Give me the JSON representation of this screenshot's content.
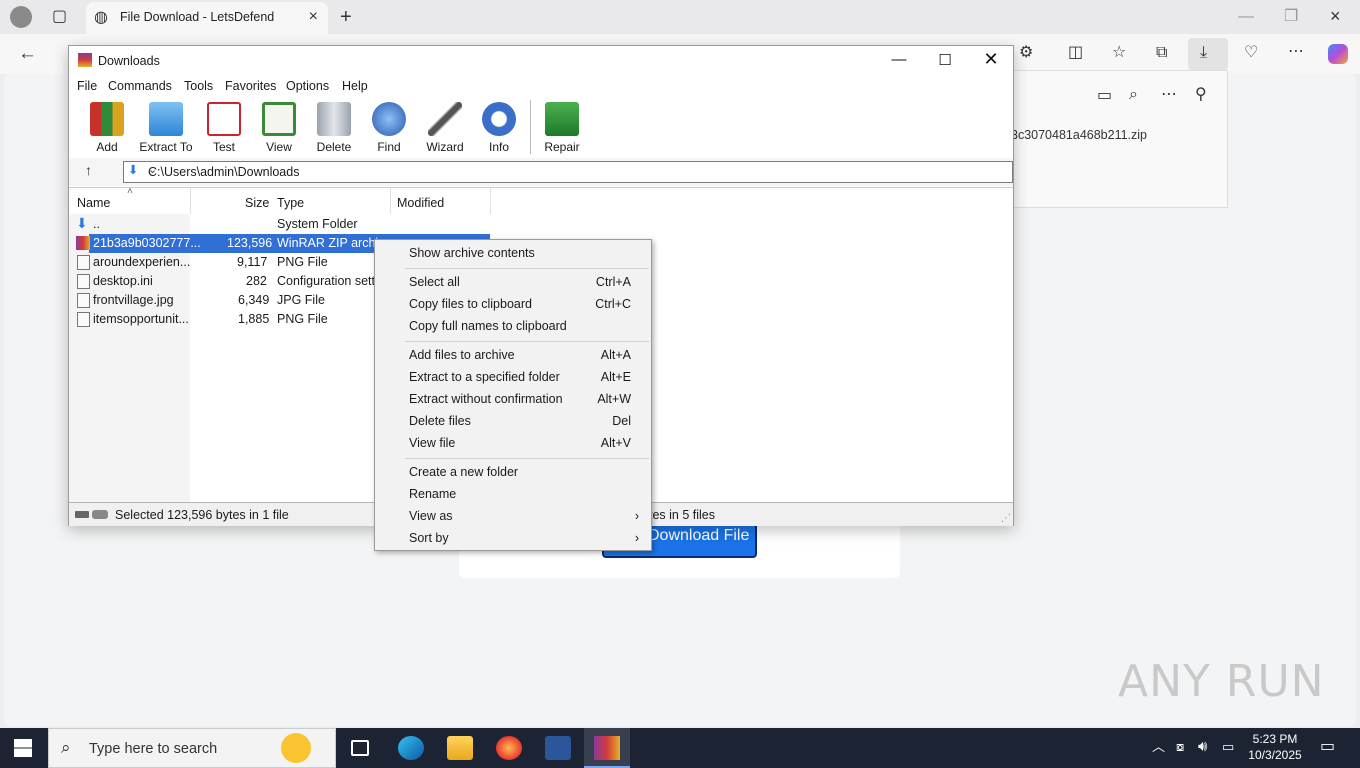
{
  "browser": {
    "tab_title": "File Download - LetsDefend",
    "download_filename": "3c3070481a468b211.zip",
    "page_button": "Download File",
    "watermark": "ANY RUN"
  },
  "winrar": {
    "title": "Downloads",
    "menu": [
      "File",
      "Commands",
      "Tools",
      "Favorites",
      "Options",
      "Help"
    ],
    "toolbar": [
      "Add",
      "Extract To",
      "Test",
      "View",
      "Delete",
      "Find",
      "Wizard",
      "Info",
      "Repair"
    ],
    "address": "C:\\Users\\admin\\Downloads",
    "columns": {
      "name": "Name",
      "size": "Size",
      "type": "Type",
      "modified": "Modified"
    },
    "files": [
      {
        "name": "..",
        "size": "",
        "type": "System Folder"
      },
      {
        "name": "21b3a9b0302777...",
        "size": "123,596",
        "type": "WinRAR ZIP archive"
      },
      {
        "name": "aroundexperien...",
        "size": "9,117",
        "type": "PNG File"
      },
      {
        "name": "desktop.ini",
        "size": "282",
        "type": "Configuration sett"
      },
      {
        "name": "frontvillage.jpg",
        "size": "6,349",
        "type": "JPG File"
      },
      {
        "name": "itemsopportunit...",
        "size": "1,885",
        "type": "PNG File"
      }
    ],
    "status_left": "Selected 123,596 bytes in 1 file",
    "status_right": "tes in 5 files"
  },
  "context_menu": [
    {
      "label": "Show archive contents",
      "key": ""
    },
    {
      "label": "Select all",
      "key": "Ctrl+A"
    },
    {
      "label": "Copy files to clipboard",
      "key": "Ctrl+C"
    },
    {
      "label": "Copy full names to clipboard",
      "key": ""
    },
    {
      "label": "Add files to archive",
      "key": "Alt+A"
    },
    {
      "label": "Extract to a specified folder",
      "key": "Alt+E"
    },
    {
      "label": "Extract without confirmation",
      "key": "Alt+W"
    },
    {
      "label": "Delete files",
      "key": "Del"
    },
    {
      "label": "View file",
      "key": "Alt+V"
    },
    {
      "label": "Create a new folder",
      "key": ""
    },
    {
      "label": "Rename",
      "key": ""
    },
    {
      "label": "View as",
      "key": "›"
    },
    {
      "label": "Sort by",
      "key": "›"
    }
  ],
  "taskbar": {
    "search_placeholder": "Type here to search",
    "time": "5:23 PM",
    "date": "10/3/2025"
  }
}
